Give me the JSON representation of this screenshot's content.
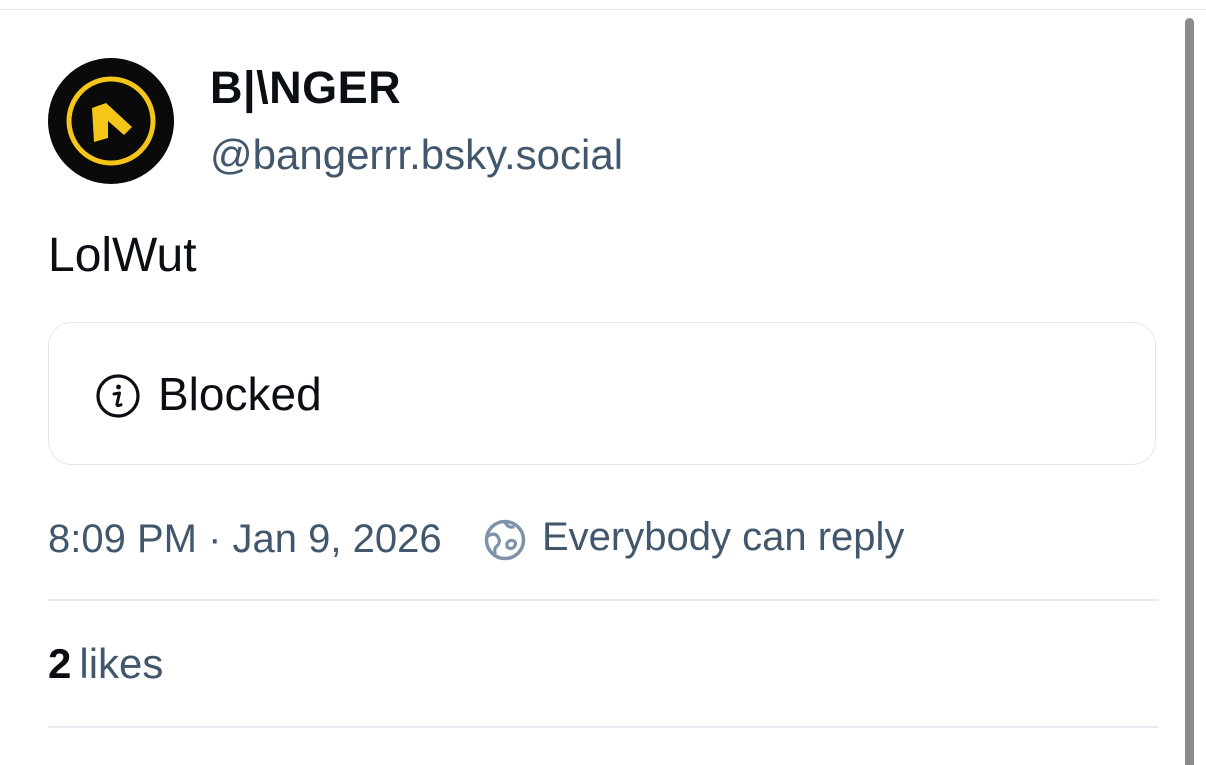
{
  "author": {
    "display_name": "B|\\NGER",
    "handle": "@bangerrr.bsky.social",
    "avatar_icon": "banger-logo-avatar"
  },
  "post": {
    "text": "LolWut",
    "embed": {
      "status_icon": "info-icon",
      "label": "Blocked"
    },
    "timestamp": "8:09 PM · Jan 9, 2026",
    "reply_setting": {
      "icon": "globe-icon",
      "label": "Everybody can reply"
    }
  },
  "engagement": {
    "likes_count": "2",
    "likes_label": "likes"
  },
  "colors": {
    "primary_text": "#0b0f14",
    "secondary_text": "#42576c",
    "divider": "#e6e9ee",
    "avatar_accent": "#f5c518"
  }
}
